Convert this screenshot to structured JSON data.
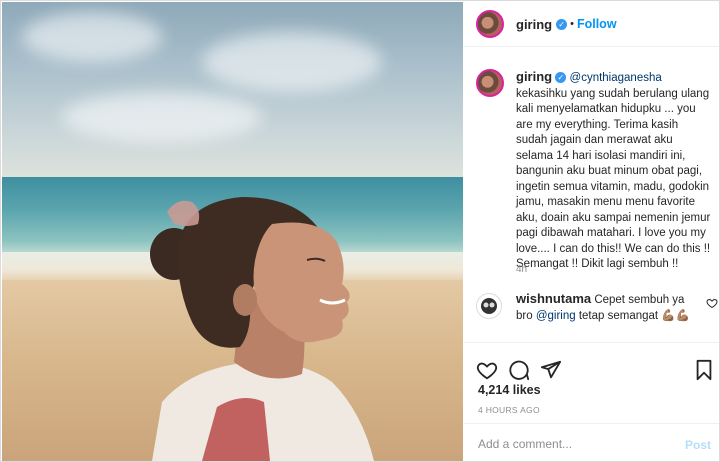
{
  "header": {
    "username": "giring",
    "follow_label": "Follow",
    "separator": "•"
  },
  "caption": {
    "username": "giring",
    "mention": "@cynthiaganesha",
    "text": " kekasihku yang sudah berulang ulang kali menyelamatkan hidupku ... you are my everything. Terima kasih sudah jagain dan merawat aku selama 14 hari isolasi mandiri ini, bangunin aku buat minum obat pagi, ingetin semua vitamin, madu, godokin jamu, masakin menu menu favorite aku, doain aku sampai nemenin jemur pagi dibawah matahari. I love you my love.... I can do this!! We can do this !! Semangat !! Dikit lagi sembuh !!",
    "time": "4h"
  },
  "comment": {
    "username": "wishnutama",
    "text_before": " Cepet sembuh ya bro ",
    "mention": "@giring",
    "text_after": " tetap semangat 💪🏽💪🏽"
  },
  "stats": {
    "likes": "4,214 likes",
    "posted": "4 HOURS AGO"
  },
  "add_comment": {
    "placeholder": "Add a comment...",
    "post_label": "Post"
  },
  "colors": {
    "link_blue": "#0095f6",
    "verified_blue": "#3897f0",
    "mention_blue": "#00376b",
    "muted": "#8e8e8e"
  },
  "icons": [
    "heart-icon",
    "comment-icon",
    "share-icon",
    "bookmark-icon",
    "verified-badge-icon"
  ]
}
